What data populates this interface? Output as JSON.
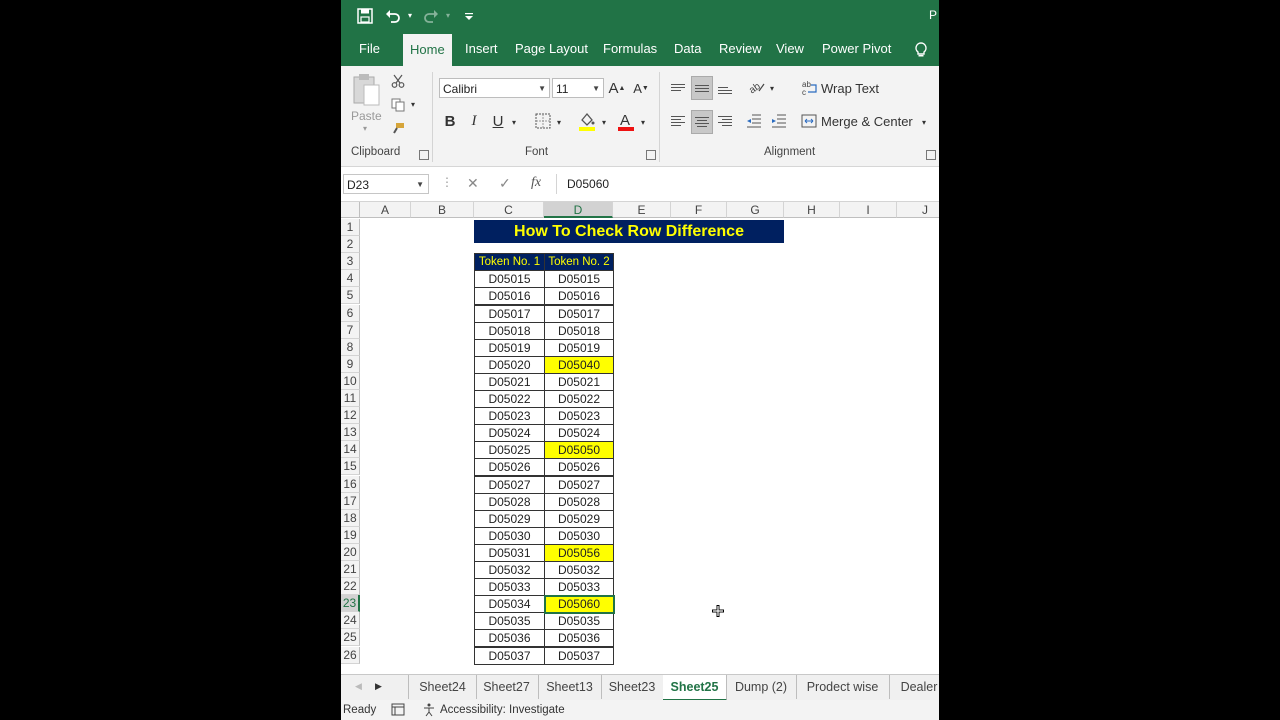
{
  "title_partial": "P",
  "qat": {
    "save": "save-icon",
    "undo": "undo-icon",
    "redo": "redo-icon",
    "customize": "▾"
  },
  "tabs": [
    "File",
    "Home",
    "Insert",
    "Page Layout",
    "Formulas",
    "Data",
    "Review",
    "View",
    "Power Pivot"
  ],
  "active_tab": "Home",
  "ribbon": {
    "clipboard": {
      "paste_label": "Paste",
      "group_label": "Clipboard"
    },
    "font": {
      "family": "Calibri",
      "size": "11",
      "bold": "B",
      "italic": "I",
      "underline": "U",
      "group_label": "Font"
    },
    "alignment": {
      "wrap_text": "Wrap Text",
      "merge_center": "Merge & Center",
      "group_label": "Alignment"
    }
  },
  "formula_bar": {
    "name_box": "D23",
    "formula": "D05060",
    "fx": "fx"
  },
  "columns": [
    "A",
    "B",
    "C",
    "D",
    "E",
    "F",
    "G",
    "H",
    "I",
    "J"
  ],
  "selected_column": "D",
  "rows": [
    "1",
    "2",
    "3",
    "4",
    "5",
    "6",
    "7",
    "8",
    "9",
    "10",
    "11",
    "12",
    "13",
    "14",
    "15",
    "16",
    "17",
    "18",
    "19",
    "20",
    "21",
    "22",
    "23",
    "24",
    "25",
    "26"
  ],
  "selected_row": "23",
  "sheet": {
    "banner": "How To Check Row Difference",
    "header": [
      "Token No. 1",
      "Token No. 2"
    ],
    "data": [
      [
        "D05015",
        "D05015",
        false
      ],
      [
        "D05016",
        "D05016",
        false
      ],
      [
        "D05017",
        "D05017",
        false
      ],
      [
        "D05018",
        "D05018",
        false
      ],
      [
        "D05019",
        "D05019",
        false
      ],
      [
        "D05020",
        "D05040",
        true
      ],
      [
        "D05021",
        "D05021",
        false
      ],
      [
        "D05022",
        "D05022",
        false
      ],
      [
        "D05023",
        "D05023",
        false
      ],
      [
        "D05024",
        "D05024",
        false
      ],
      [
        "D05025",
        "D05050",
        true
      ],
      [
        "D05026",
        "D05026",
        false
      ],
      [
        "D05027",
        "D05027",
        false
      ],
      [
        "D05028",
        "D05028",
        false
      ],
      [
        "D05029",
        "D05029",
        false
      ],
      [
        "D05030",
        "D05030",
        false
      ],
      [
        "D05031",
        "D05056",
        true
      ],
      [
        "D05032",
        "D05032",
        false
      ],
      [
        "D05033",
        "D05033",
        false
      ],
      [
        "D05034",
        "D05060",
        true
      ],
      [
        "D05035",
        "D05035",
        false
      ],
      [
        "D05036",
        "D05036",
        false
      ],
      [
        "D05037",
        "D05037",
        false
      ]
    ]
  },
  "sheet_tabs": [
    "Sheet24",
    "Sheet27",
    "Sheet13",
    "Sheet23",
    "Sheet25",
    "Dump (2)",
    "Prodect wise",
    "Dealer"
  ],
  "active_sheet": "Sheet25",
  "status": {
    "ready": "Ready",
    "accessibility": "Accessibility: Investigate"
  },
  "colors": {
    "excel_green": "#217346",
    "banner_bg": "#002060",
    "banner_text": "#ffff00",
    "highlight": "#ffff00"
  }
}
